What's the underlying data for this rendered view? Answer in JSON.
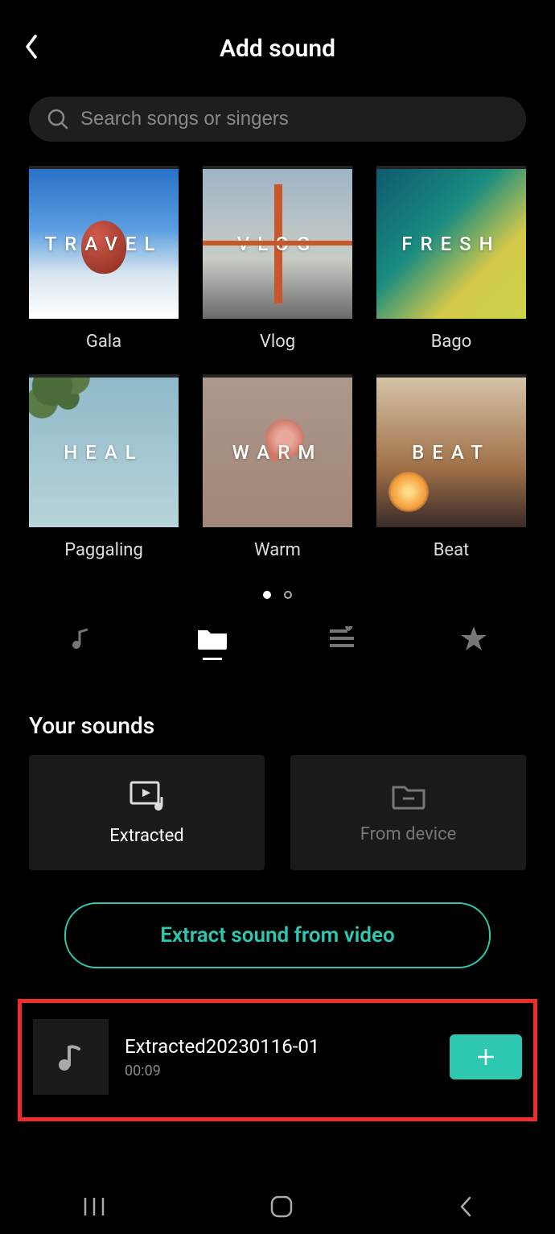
{
  "header": {
    "title": "Add sound"
  },
  "search": {
    "placeholder": "Search songs or singers"
  },
  "categories": [
    {
      "overlay": "TRAVEL",
      "label": "Gala",
      "bg": "bg-travel",
      "decor": "decor-balloon"
    },
    {
      "overlay": "VLOG",
      "label": "Vlog",
      "bg": "bg-vlog",
      "decor": "decor-bridge"
    },
    {
      "overlay": "FRESH",
      "label": "Bago",
      "bg": "bg-fresh",
      "decor": ""
    },
    {
      "overlay": "HEAL",
      "label": "Paggaling",
      "bg": "bg-heal",
      "decor": "decor-leaves"
    },
    {
      "overlay": "WARM",
      "label": "Warm",
      "bg": "bg-warm",
      "decor": "decor-rose"
    },
    {
      "overlay": "BEAT",
      "label": "Beat",
      "bg": "bg-beat",
      "decor": "decor-sun"
    }
  ],
  "section": {
    "title": "Your sounds"
  },
  "sources": {
    "extracted": "Extracted",
    "device": "From device"
  },
  "extract_btn": "Extract sound from video",
  "sound": {
    "name": "Extracted20230116-01",
    "duration": "00:09"
  },
  "colors": {
    "accent": "#2ec7b0",
    "highlight": "#ef2d2d"
  }
}
